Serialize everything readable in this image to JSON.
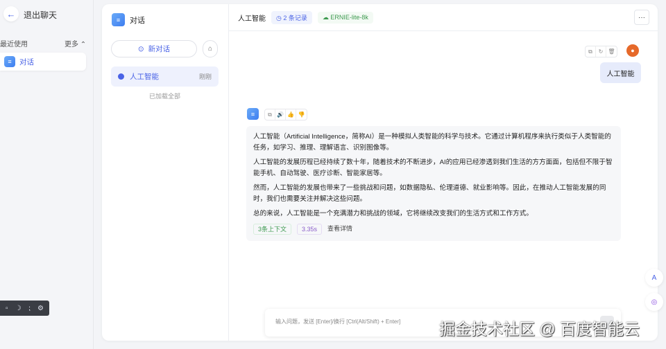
{
  "sidebar": {
    "exit_label": "退出聊天",
    "recent_label": "最近使用",
    "more_label": "更多 ⌃",
    "items": [
      {
        "label": "对话"
      }
    ]
  },
  "panel": {
    "title": "对话",
    "new_chat_label": "新对话",
    "conversations": [
      {
        "title": "人工智能",
        "time": "刚刚"
      }
    ],
    "loaded_all": "已加载全部"
  },
  "header": {
    "title": "人工智能",
    "records": "2 条记录",
    "model": "ERNIE-lite-8k",
    "more": "···"
  },
  "messages": {
    "user": {
      "text": "人工智能"
    },
    "assistant": {
      "paragraphs": [
        "人工智能（Artificial Intelligence，简称AI）是一种模拟人类智能的科学与技术。它通过计算机程序来执行类似于人类智能的任务，如学习、推理、理解语言、识别图像等。",
        "人工智能的发展历程已经持续了数十年，随着技术的不断进步，AI的应用已经渗透到我们生活的方方面面，包括但不限于智能手机、自动驾驶、医疗诊断、智能家居等。",
        "然而，人工智能的发展也带来了一些挑战和问题，如数据隐私、伦理道德、就业影响等。因此，在推动人工智能发展的同时，我们也需要关注并解决这些问题。",
        "总的来说，人工智能是一个充满潜力和挑战的领域，它将继续改变我们的生活方式和工作方式。"
      ],
      "context": "3条上下文",
      "duration": "3.35s",
      "details": "查看详情"
    }
  },
  "input": {
    "placeholder": "输入问题，发送 [Enter]/换行 [Ctrl(Alt/Shift) + Enter]"
  },
  "watermark": "掘金技术社区 @ 百度智能云"
}
